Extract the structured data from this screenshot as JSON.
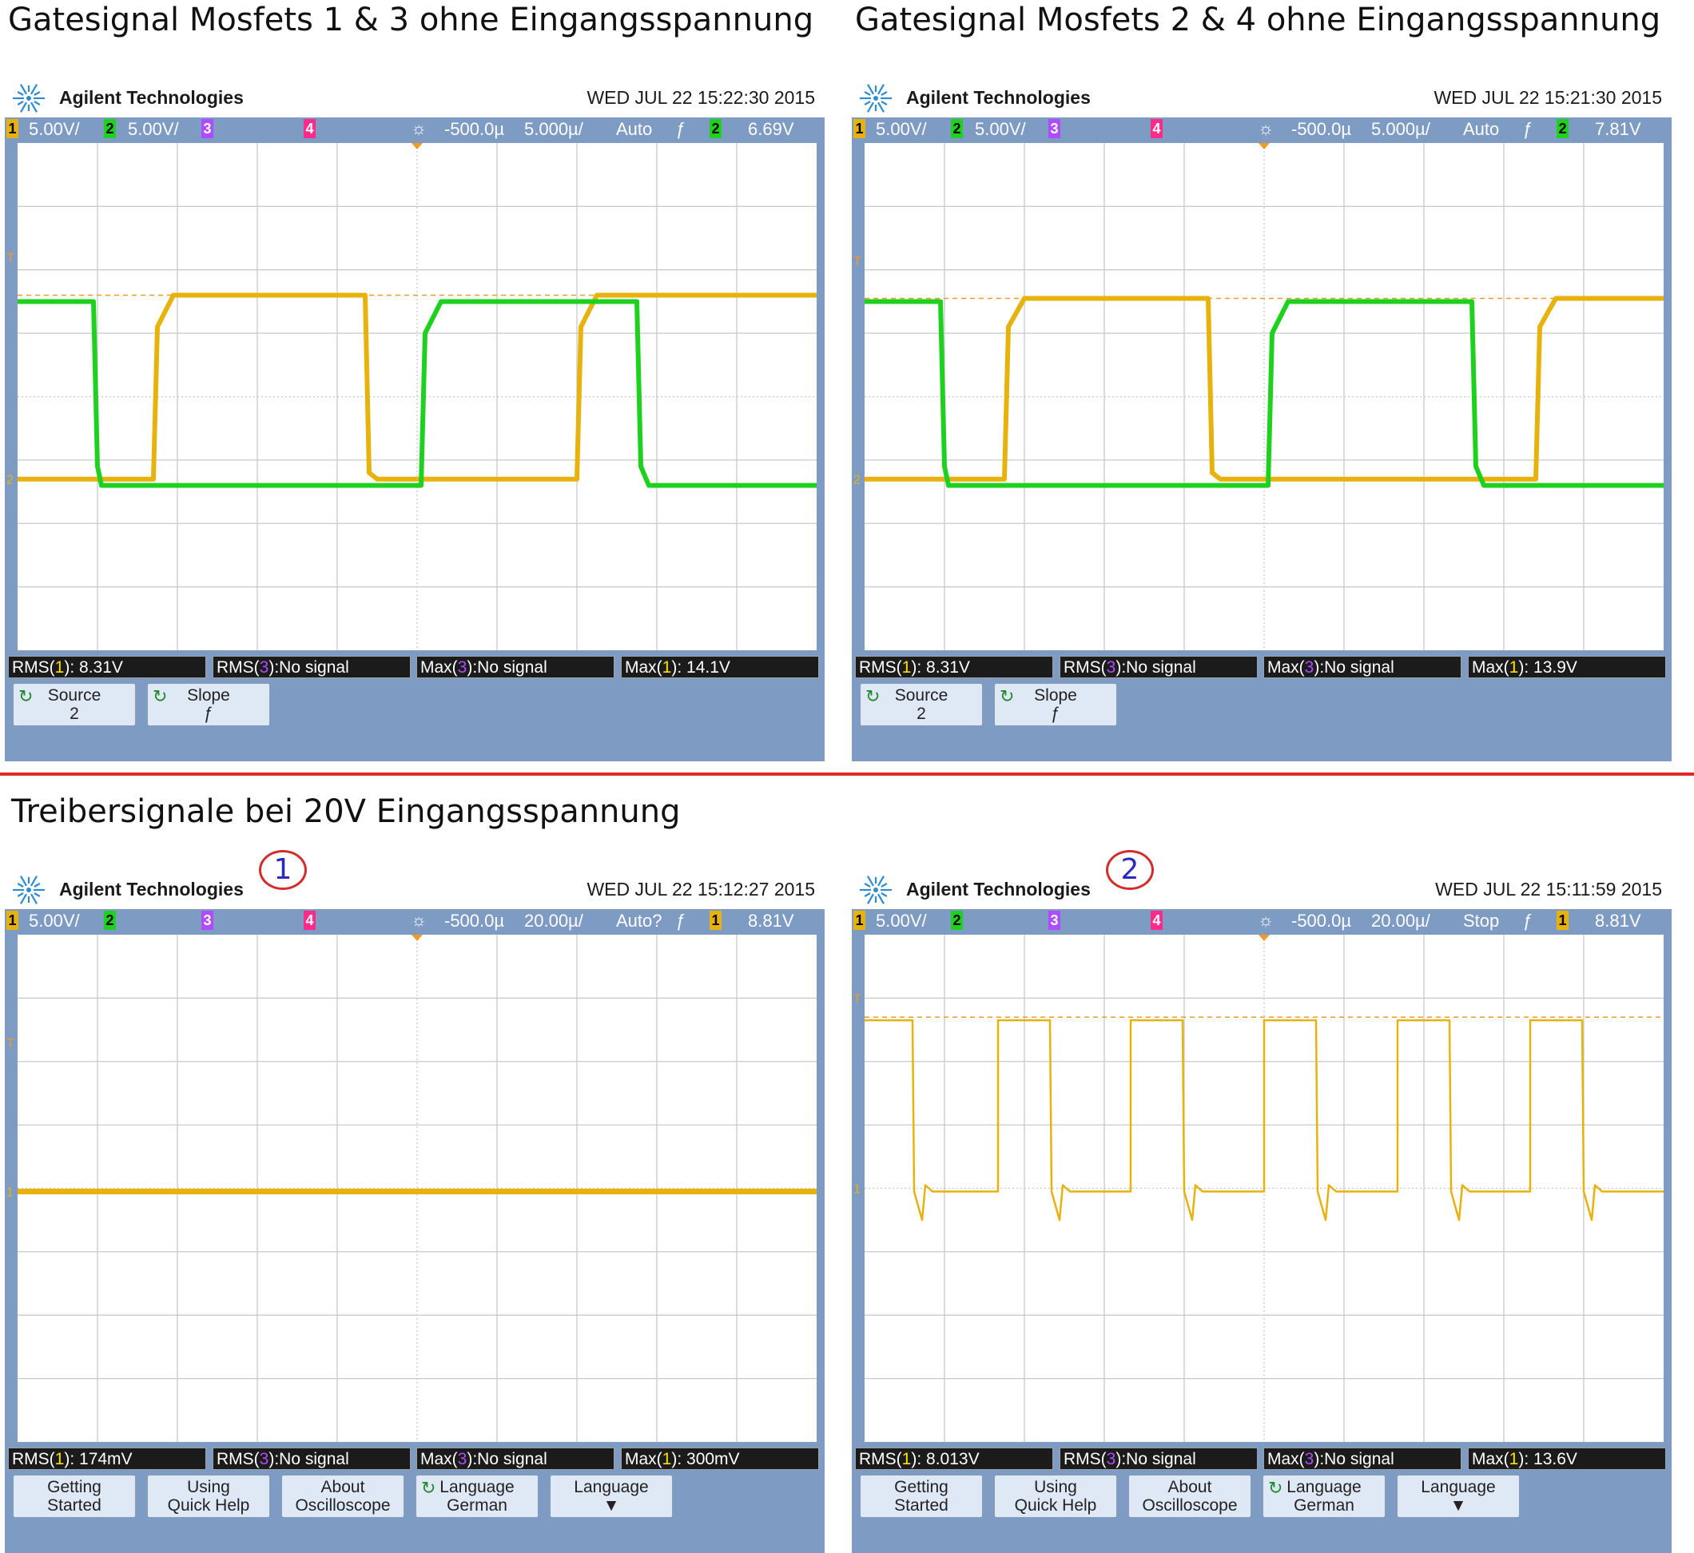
{
  "titles": {
    "top_left": "Gatesignal Mosfets 1 & 3 ohne Eingangsspannung",
    "top_right": "Gatesignal Mosfets 2 & 4 ohne Eingangsspannung",
    "bottom": "Treibersignale bei 20V Eingangsspannung"
  },
  "colors": {
    "ch1": "#e8b20c",
    "ch2": "#1fd11f",
    "ch3": "#b04cff",
    "ch4": "#ff2a8a",
    "screen_bg": "#ffffff",
    "frame": "#7e9bc3",
    "grid": "#c8c8c8",
    "trigger_level": "#f09a28",
    "divider": "#e1262d",
    "badge_ring": "#d42b2b",
    "badge_text": "#2a2ac0"
  },
  "scopes": [
    {
      "id": "s1",
      "brand": "Agilent Technologies",
      "logo_icon": "agilent-spark-icon",
      "datetime": "WED JUL 22 15:22:30 2015",
      "badge": "",
      "status": {
        "ch1_num": "1",
        "ch1_scale": "5.00V/",
        "ch2_num": "2",
        "ch2_scale": "5.00V/",
        "ch3_num": "3",
        "ch4_num": "4",
        "delay": "-500.0µ",
        "timebase": "5.000µ/",
        "mode": "Auto",
        "slope_icon": "ƒ",
        "trig_src": "2",
        "trig_level": "6.69V"
      },
      "measurements": [
        {
          "pre": "RMS(",
          "ch": "1",
          "post": "): 8.31V",
          "chcolor": "n"
        },
        {
          "pre": "RMS(",
          "ch": "3",
          "post": "):No signal",
          "chcolor": "p"
        },
        {
          "pre": "Max(",
          "ch": "3",
          "post": "):No signal",
          "chcolor": "p"
        },
        {
          "pre": "Max(",
          "ch": "1",
          "post": "): 14.1V",
          "chcolor": "n"
        }
      ],
      "softkeys": [
        {
          "line1": "Source",
          "line2": "2",
          "icon": "↻",
          "icon_name": "rotate-knob-icon"
        },
        {
          "line1": "Slope",
          "line2": "ƒ",
          "icon": "↻",
          "icon_name": "rotate-knob-icon"
        }
      ]
    },
    {
      "id": "s2",
      "brand": "Agilent Technologies",
      "logo_icon": "agilent-spark-icon",
      "datetime": "WED JUL 22 15:21:30 2015",
      "badge": "",
      "status": {
        "ch1_num": "1",
        "ch1_scale": "5.00V/",
        "ch2_num": "2",
        "ch2_scale": "5.00V/",
        "ch3_num": "3",
        "ch4_num": "4",
        "delay": "-500.0µ",
        "timebase": "5.000µ/",
        "mode": "Auto",
        "slope_icon": "ƒ",
        "trig_src": "2",
        "trig_level": "7.81V"
      },
      "measurements": [
        {
          "pre": "RMS(",
          "ch": "1",
          "post": "): 8.31V",
          "chcolor": "n"
        },
        {
          "pre": "RMS(",
          "ch": "3",
          "post": "):No signal",
          "chcolor": "p"
        },
        {
          "pre": "Max(",
          "ch": "3",
          "post": "):No signal",
          "chcolor": "p"
        },
        {
          "pre": "Max(",
          "ch": "1",
          "post": "): 13.9V",
          "chcolor": "n"
        }
      ],
      "softkeys": [
        {
          "line1": "Source",
          "line2": "2",
          "icon": "↻",
          "icon_name": "rotate-knob-icon"
        },
        {
          "line1": "Slope",
          "line2": "ƒ",
          "icon": "↻",
          "icon_name": "rotate-knob-icon"
        }
      ]
    },
    {
      "id": "s3",
      "brand": "Agilent Technologies",
      "logo_icon": "agilent-spark-icon",
      "datetime": "WED JUL 22 15:12:27 2015",
      "badge": "1",
      "status": {
        "ch1_num": "1",
        "ch1_scale": "5.00V/",
        "ch2_num": "2",
        "ch2_scale": "",
        "ch3_num": "3",
        "ch4_num": "4",
        "delay": "-500.0µ",
        "timebase": "20.00µ/",
        "mode": "Auto?",
        "slope_icon": "ƒ",
        "trig_src": "1",
        "trig_level": "8.81V"
      },
      "measurements": [
        {
          "pre": "RMS(",
          "ch": "1",
          "post": "): 174mV",
          "chcolor": "n"
        },
        {
          "pre": "RMS(",
          "ch": "3",
          "post": "):No signal",
          "chcolor": "p"
        },
        {
          "pre": "Max(",
          "ch": "3",
          "post": "):No signal",
          "chcolor": "p"
        },
        {
          "pre": "Max(",
          "ch": "1",
          "post": "): 300mV",
          "chcolor": "n"
        }
      ],
      "softkeys": [
        {
          "line1": "Getting",
          "line2": "Started",
          "icon": "",
          "icon_name": ""
        },
        {
          "line1": "Using",
          "line2": "Quick Help",
          "icon": "",
          "icon_name": ""
        },
        {
          "line1": "About",
          "line2": "Oscilloscope",
          "icon": "",
          "icon_name": ""
        },
        {
          "line1": "Language",
          "line2": "German",
          "icon": "↻",
          "icon_name": "rotate-knob-icon"
        },
        {
          "line1": "Language",
          "line2": "▼",
          "icon": "",
          "icon_name": "down-arrow-icon"
        }
      ]
    },
    {
      "id": "s4",
      "brand": "Agilent Technologies",
      "logo_icon": "agilent-spark-icon",
      "datetime": "WED JUL 22 15:11:59 2015",
      "badge": "2",
      "status": {
        "ch1_num": "1",
        "ch1_scale": "5.00V/",
        "ch2_num": "2",
        "ch2_scale": "",
        "ch3_num": "3",
        "ch4_num": "4",
        "delay": "-500.0µ",
        "timebase": "20.00µ/",
        "mode": "Stop",
        "slope_icon": "ƒ",
        "trig_src": "1",
        "trig_level": "8.81V"
      },
      "measurements": [
        {
          "pre": "RMS(",
          "ch": "1",
          "post": "): 8.013V",
          "chcolor": "n"
        },
        {
          "pre": "RMS(",
          "ch": "3",
          "post": "):No signal",
          "chcolor": "p"
        },
        {
          "pre": "Max(",
          "ch": "3",
          "post": "):No signal",
          "chcolor": "p"
        },
        {
          "pre": "Max(",
          "ch": "1",
          "post": "): 13.6V",
          "chcolor": "n"
        }
      ],
      "softkeys": [
        {
          "line1": "Getting",
          "line2": "Started",
          "icon": "",
          "icon_name": ""
        },
        {
          "line1": "Using",
          "line2": "Quick Help",
          "icon": "",
          "icon_name": ""
        },
        {
          "line1": "About",
          "line2": "Oscilloscope",
          "icon": "",
          "icon_name": ""
        },
        {
          "line1": "Language",
          "line2": "German",
          "icon": "↻",
          "icon_name": "rotate-knob-icon"
        },
        {
          "line1": "Language",
          "line2": "▼",
          "icon": "",
          "icon_name": "down-arrow-icon"
        }
      ]
    }
  ],
  "chart_data": [
    {
      "type": "line",
      "scope": "s1",
      "x_divisions": 10,
      "y_divisions": 8,
      "x_range_div": [
        0,
        10
      ],
      "y_range_div": [
        -4,
        4
      ],
      "ch1_ref_div": -1.3,
      "ch2_ref_div": -1.3,
      "trigger_level_div": 1.6,
      "series": [
        {
          "channel": "1",
          "color_key": "ch1",
          "points_div": [
            [
              0,
              -1.3
            ],
            [
              1.7,
              -1.3
            ],
            [
              1.75,
              1.1
            ],
            [
              1.95,
              1.6
            ],
            [
              4.35,
              1.6
            ],
            [
              4.4,
              -1.2
            ],
            [
              4.5,
              -1.3
            ],
            [
              7.0,
              -1.3
            ],
            [
              7.05,
              1.1
            ],
            [
              7.25,
              1.6
            ],
            [
              10,
              1.6
            ]
          ]
        },
        {
          "channel": "2",
          "color_key": "ch2",
          "points_div": [
            [
              0,
              1.5
            ],
            [
              0.95,
              1.5
            ],
            [
              1.0,
              -1.1
            ],
            [
              1.05,
              -1.4
            ],
            [
              5.05,
              -1.4
            ],
            [
              5.1,
              1.0
            ],
            [
              5.3,
              1.5
            ],
            [
              7.75,
              1.5
            ],
            [
              7.8,
              -1.1
            ],
            [
              7.9,
              -1.4
            ],
            [
              10,
              -1.4
            ]
          ]
        }
      ]
    },
    {
      "type": "line",
      "scope": "s2",
      "x_divisions": 10,
      "y_divisions": 8,
      "x_range_div": [
        0,
        10
      ],
      "y_range_div": [
        -4,
        4
      ],
      "ch1_ref_div": -1.3,
      "ch2_ref_div": -1.3,
      "trigger_level_div": 1.55,
      "series": [
        {
          "channel": "1",
          "color_key": "ch1",
          "points_div": [
            [
              0,
              -1.3
            ],
            [
              1.75,
              -1.3
            ],
            [
              1.8,
              1.1
            ],
            [
              2.0,
              1.55
            ],
            [
              4.3,
              1.55
            ],
            [
              4.35,
              -1.2
            ],
            [
              4.45,
              -1.3
            ],
            [
              8.4,
              -1.3
            ],
            [
              8.45,
              1.1
            ],
            [
              8.65,
              1.55
            ],
            [
              10,
              1.55
            ]
          ]
        },
        {
          "channel": "2",
          "color_key": "ch2",
          "points_div": [
            [
              0,
              1.5
            ],
            [
              0.95,
              1.5
            ],
            [
              1.0,
              -1.1
            ],
            [
              1.05,
              -1.4
            ],
            [
              5.05,
              -1.4
            ],
            [
              5.1,
              1.0
            ],
            [
              5.3,
              1.5
            ],
            [
              7.6,
              1.5
            ],
            [
              7.65,
              -1.1
            ],
            [
              7.75,
              -1.4
            ],
            [
              10,
              -1.4
            ]
          ]
        }
      ]
    },
    {
      "type": "line",
      "scope": "s3",
      "x_divisions": 10,
      "y_divisions": 8,
      "x_range_div": [
        0,
        10
      ],
      "y_range_div": [
        -4,
        4
      ],
      "ch1_ref_div": -0.05,
      "trigger_level_div": null,
      "series": [
        {
          "channel": "1",
          "color_key": "ch1",
          "points_div": [
            [
              0,
              -0.05
            ],
            [
              10,
              -0.05
            ]
          ]
        }
      ]
    },
    {
      "type": "line",
      "scope": "s4",
      "x_divisions": 10,
      "y_divisions": 8,
      "x_range_div": [
        0,
        10
      ],
      "y_range_div": [
        -4,
        4
      ],
      "ch1_ref_div": 0,
      "trigger_level_div": 2.7,
      "series": [
        {
          "channel": "1",
          "color_key": "ch1",
          "pulse_train": {
            "high_div": 2.65,
            "low_div": -0.05,
            "periods": [
              [
                0,
                0.6
              ],
              [
                1.67,
                2.32
              ],
              [
                3.33,
                3.98
              ],
              [
                5.0,
                5.65
              ],
              [
                6.67,
                7.32
              ],
              [
                8.33,
                8.98
              ]
            ]
          }
        }
      ]
    }
  ]
}
